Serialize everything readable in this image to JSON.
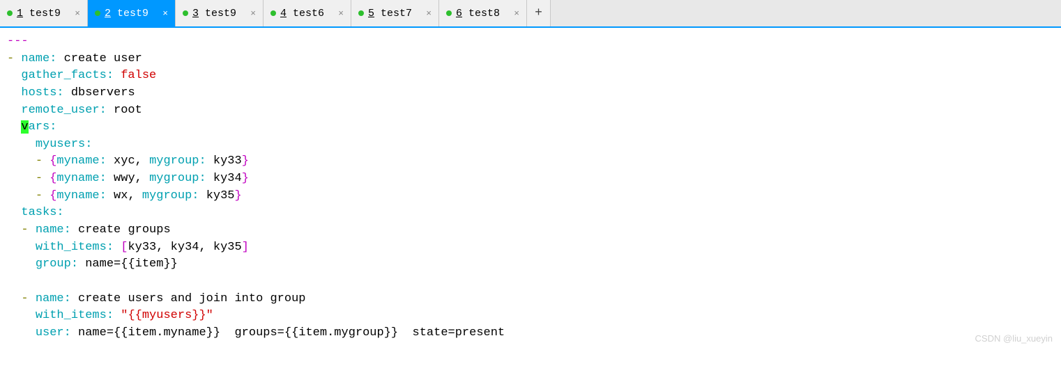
{
  "tabs": [
    {
      "num": "1",
      "name": "test9",
      "active": false
    },
    {
      "num": "2",
      "name": "test9",
      "active": true
    },
    {
      "num": "3",
      "name": "test9",
      "active": false
    },
    {
      "num": "4",
      "name": "test6",
      "active": false
    },
    {
      "num": "5",
      "name": "test7",
      "active": false
    },
    {
      "num": "6",
      "name": "test8",
      "active": false
    }
  ],
  "newTabLabel": "+",
  "closeGlyph": "×",
  "code": {
    "docStart": "---",
    "dash": "-",
    "k_name": "name",
    "k_gather_facts": "gather_facts",
    "k_hosts": "hosts",
    "k_remote_user": "remote_user",
    "k_vars_v": "v",
    "k_vars_ars": "ars",
    "k_myusers": "myusers",
    "k_myname": "myname",
    "k_mygroup": "mygroup",
    "k_tasks": "tasks",
    "k_with_items": "with_items",
    "k_group": "group",
    "k_user": "user",
    "v_create_user": "create user",
    "v_false": "false",
    "v_dbservers": "dbservers",
    "v_root": "root",
    "v_xyc": "xyc",
    "v_wwy": "wwy",
    "v_wx": "wx",
    "v_ky33": "ky33",
    "v_ky34": "ky34",
    "v_ky35": "ky35",
    "v_create_groups": "create groups",
    "v_group_expr": "name={{item}}",
    "v_create_users_join": "create users and join into group",
    "v_myusers_tmpl": "\"{{myusers}}\"",
    "v_user_expr": "name={{item.myname}}  groups={{item.mygroup}}  state=present",
    "colon": ":",
    "comma": ",",
    "lbrace": "{",
    "rbrace": "}",
    "lbracket": "[",
    "rbracket": "]"
  },
  "watermark": "CSDN @liu_xueyin"
}
